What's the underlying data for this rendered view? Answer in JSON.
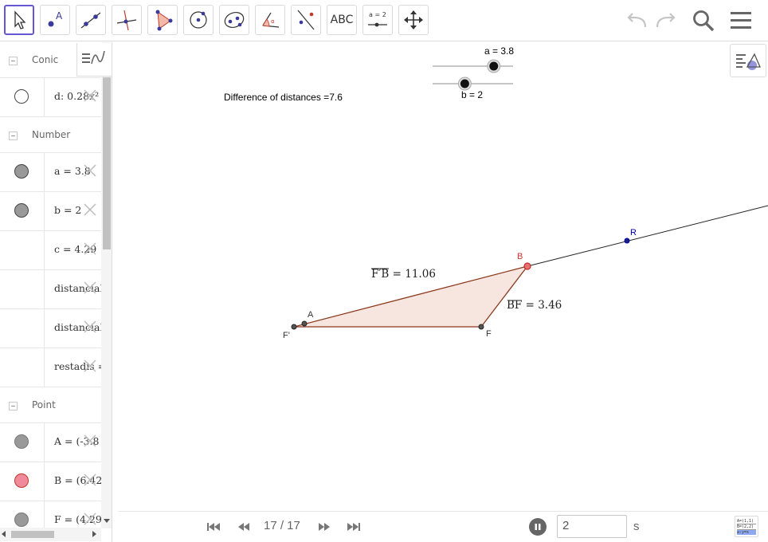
{
  "toolbar": {
    "tools": [
      "move-tool",
      "point-tool",
      "line-tool",
      "perpendicular-line-tool",
      "polygon-tool",
      "circle-center-tool",
      "ellipse-tool",
      "angle-tool",
      "reflect-tool",
      "text-tool",
      "slider-tool",
      "move-graphics-tool"
    ],
    "text_tool_label": "ABC",
    "slider_tool_label": "a = 2"
  },
  "algebra": {
    "groups": [
      {
        "label": "Conic",
        "items": [
          {
            "text": "d: 0.28x² -",
            "color": "#ffffff"
          }
        ]
      },
      {
        "label": "Number",
        "items": [
          {
            "text": "a = 3.8",
            "color": "#999999"
          },
          {
            "text": "b = 2",
            "color": "#999999"
          },
          {
            "text": "c = 4.29",
            "color": ""
          },
          {
            "text": "distanciaB",
            "color": ""
          },
          {
            "text": "distanciaF",
            "color": ""
          },
          {
            "text": "restadis =",
            "color": ""
          }
        ]
      },
      {
        "label": "Point",
        "items": [
          {
            "text": "A = (-3.8",
            "color": "#999999"
          },
          {
            "text": "B = (6.42",
            "color": "#f08a9a"
          },
          {
            "text": "F = (4.29",
            "color": "#999999"
          }
        ]
      }
    ]
  },
  "graphics": {
    "difference_text": "Difference of distances =7.6",
    "slider_a_label": "a = 3.8",
    "slider_b_label": "b = 2",
    "slider_a_value": 3.8,
    "slider_b_value": 2,
    "label_FprimeB": "F′B",
    "value_FprimeB": "= 11.06",
    "label_BF": "BF",
    "value_BF": "= 3.46",
    "points": {
      "A": {
        "label": "A",
        "color": "#333333"
      },
      "B": {
        "label": "B",
        "color": "#d32f2f"
      },
      "F": {
        "label": "F",
        "color": "#333333"
      },
      "Fp": {
        "label": "F'",
        "color": "#333333"
      },
      "R": {
        "label": "R",
        "color": "#0000aa"
      }
    }
  },
  "playback": {
    "page_count": "17 / 17",
    "time_value": "2",
    "time_unit": "s"
  }
}
